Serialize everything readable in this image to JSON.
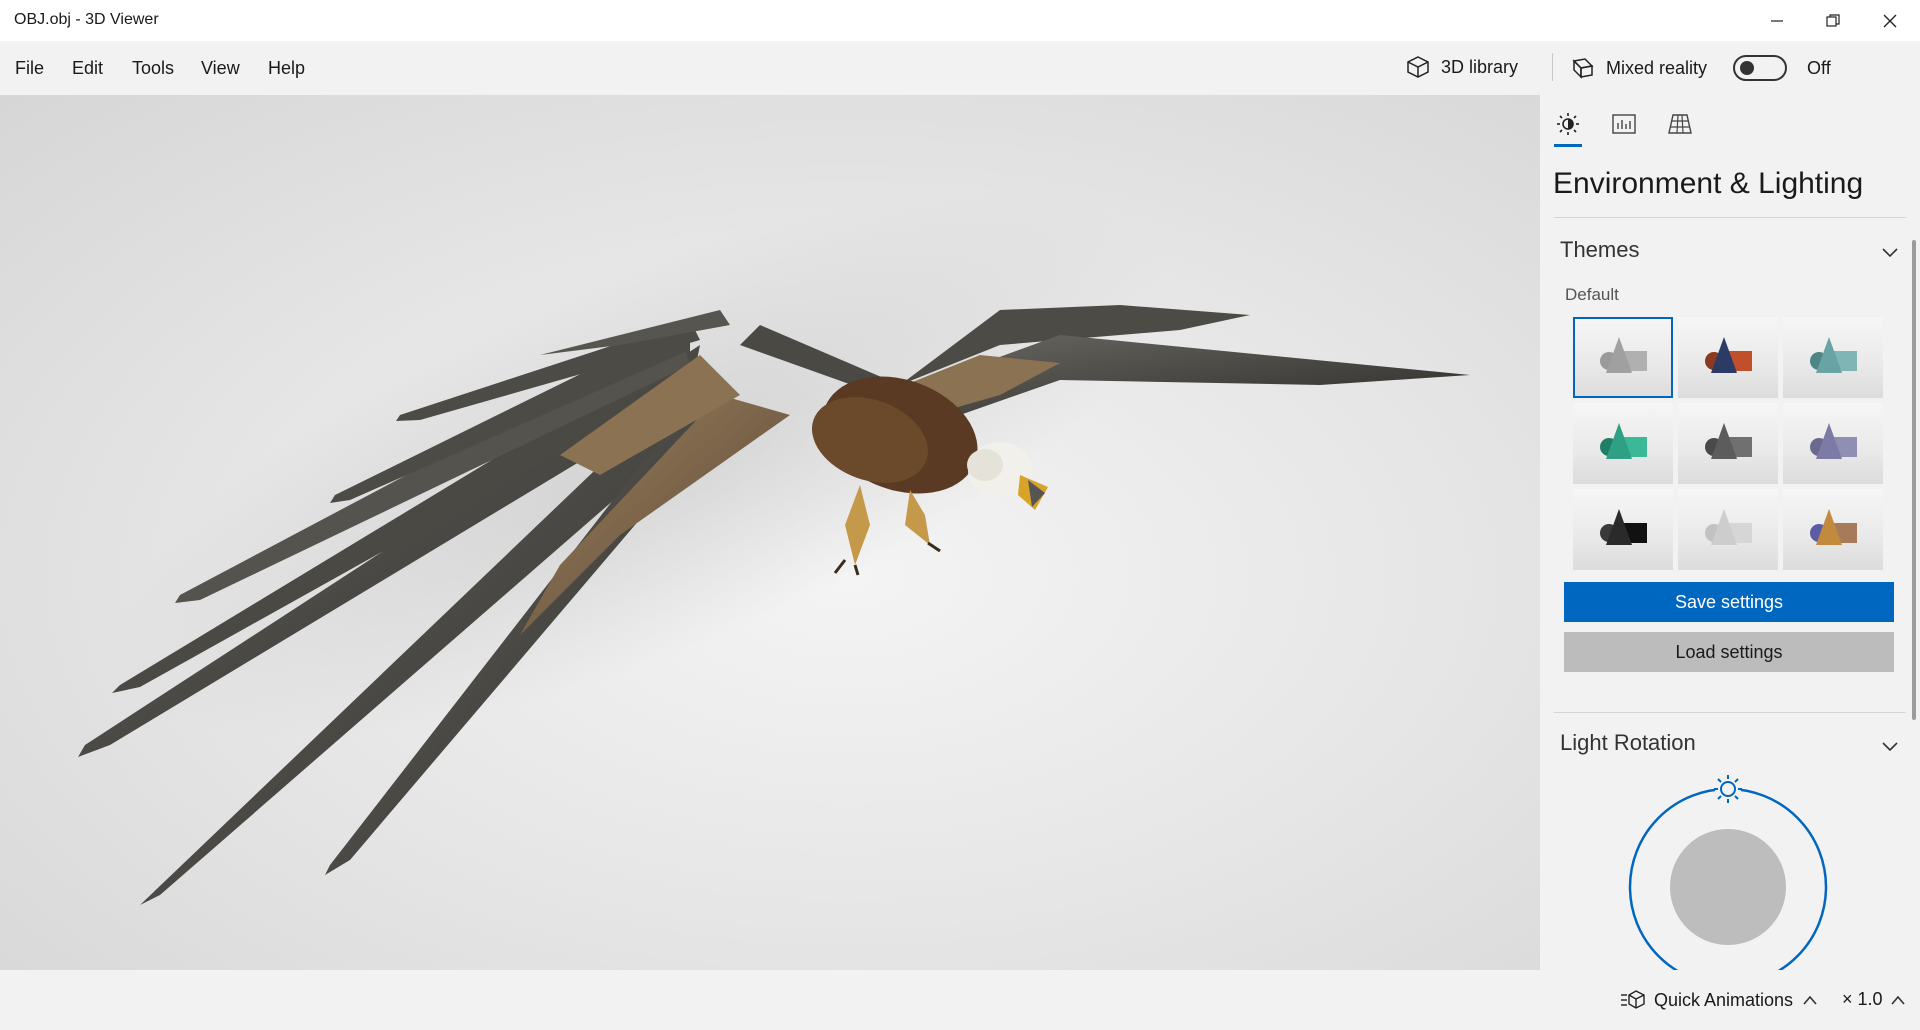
{
  "window": {
    "title": "OBJ.obj - 3D Viewer",
    "controls": [
      "minimize",
      "restore",
      "close"
    ]
  },
  "menu": {
    "file": "File",
    "edit": "Edit",
    "tools": "Tools",
    "view": "View",
    "help": "Help"
  },
  "toolbar": {
    "library_label": "3D library",
    "mixed_reality_label": "Mixed reality",
    "mixed_reality_state": "Off",
    "mixed_reality_on": false
  },
  "panel": {
    "tabs": [
      {
        "name": "environment-lighting",
        "icon": "sun-icon",
        "active": true
      },
      {
        "name": "stats-shading",
        "icon": "stats-icon",
        "active": false
      },
      {
        "name": "mesh-grid",
        "icon": "grid-icon",
        "active": false
      }
    ],
    "title": "Environment & Lighting",
    "themes": {
      "title": "Themes",
      "subtitle": "Default",
      "selected_index": 0,
      "items": [
        {
          "cone": "#a0a0a0",
          "box": "#b0b0b0",
          "sphere": "#9a9a9a"
        },
        {
          "cone": "#2c3a66",
          "box": "#c0502c",
          "sphere": "#8a3a1e"
        },
        {
          "cone": "#6aa3a3",
          "box": "#7fb5b5",
          "sphere": "#4e8585"
        },
        {
          "cone": "#2fa083",
          "box": "#3bb896",
          "sphere": "#1f7f66"
        },
        {
          "cone": "#5c5c5c",
          "box": "#707070",
          "sphere": "#4a4a4a"
        },
        {
          "cone": "#7e7aa6",
          "box": "#8f8fb3",
          "sphere": "#6a6a8f"
        },
        {
          "cone": "#2a2a2a",
          "box": "#111111",
          "sphere": "#3a3a3a"
        },
        {
          "cone": "#cdcdcd",
          "box": "#d6d6d6",
          "sphere": "#c2c2c2"
        },
        {
          "cone": "#c28a3c",
          "box": "#a77a5c",
          "sphere": "#5c5ca6"
        }
      ]
    },
    "save_label": "Save settings",
    "load_label": "Load settings",
    "light_rotation_title": "Light Rotation"
  },
  "bottom": {
    "quick_animations_label": "Quick Animations",
    "speed_label": "× 1.0"
  },
  "colors": {
    "accent": "#0067c0",
    "chrome": "#f2f2f2",
    "secondary_button": "#bcbcbc"
  }
}
